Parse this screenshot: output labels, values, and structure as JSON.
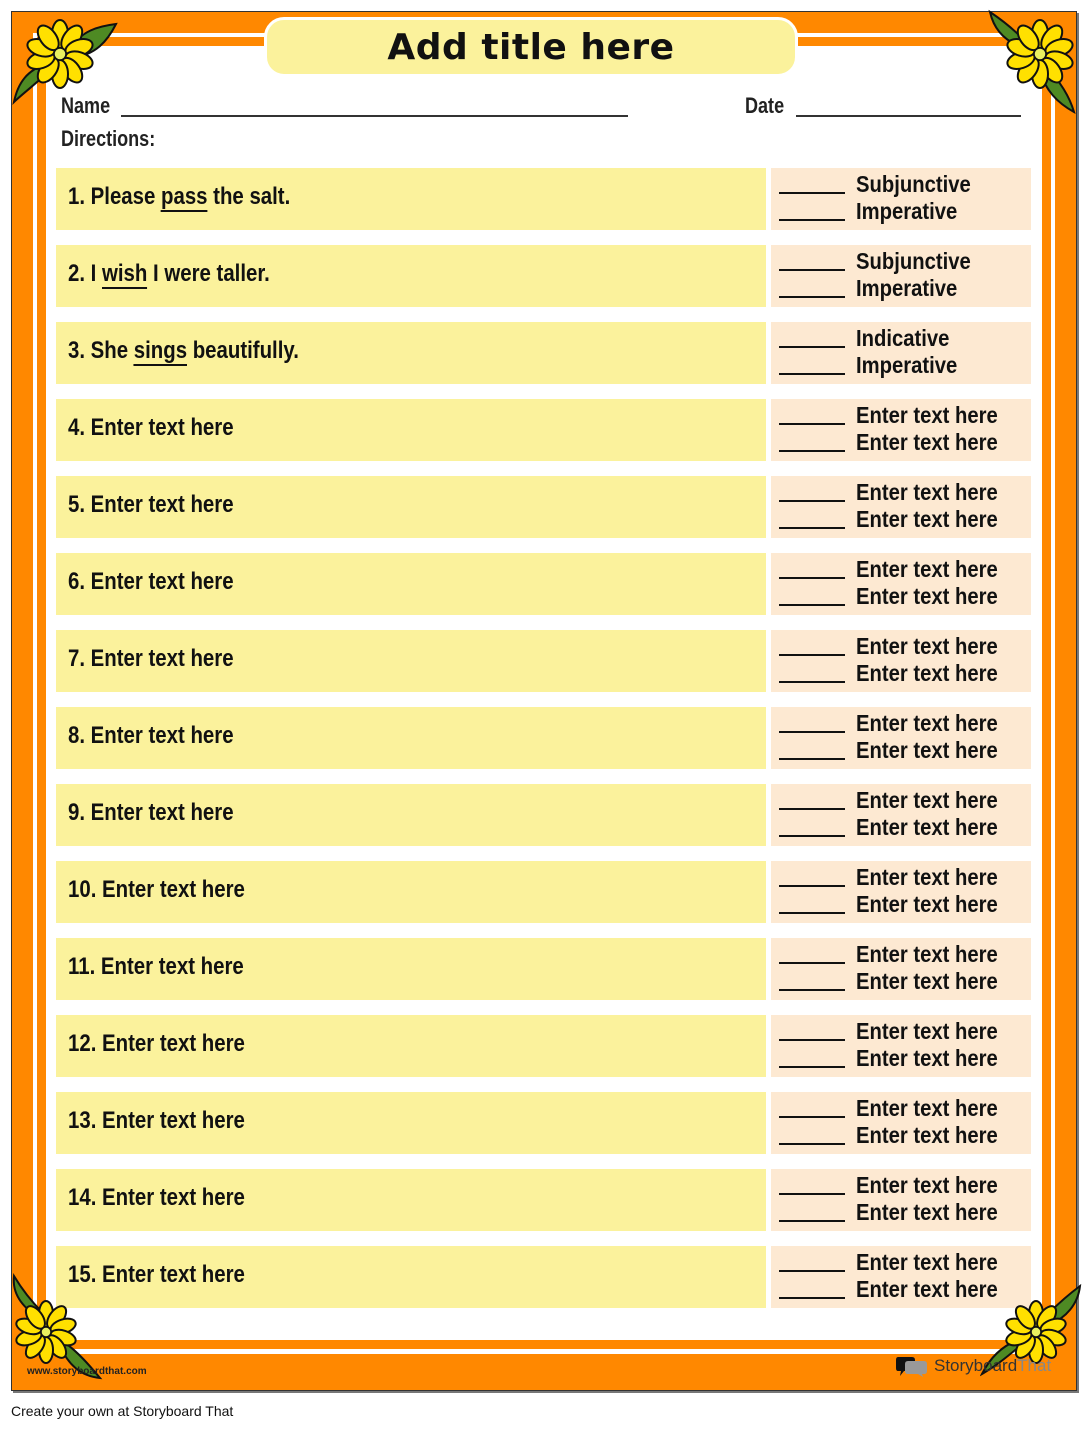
{
  "worksheet": {
    "title": "Add title here",
    "name_label": "Name",
    "date_label": "Date",
    "directions_label": "Directions:",
    "colors": {
      "border_orange": "#ff8800",
      "question_bg": "#fbf29c",
      "options_bg": "#fde9d2",
      "flower_yellow": "#ffe000",
      "leaf_green": "#4e8a23"
    },
    "questions": [
      {
        "number": "1.",
        "before": "Please ",
        "underlined": "pass",
        "after": " the salt.",
        "options": [
          "Subjunctive",
          "Imperative"
        ]
      },
      {
        "number": "2.",
        "before": "I ",
        "underlined": "wish",
        "after": " I were taller.",
        "options": [
          "Subjunctive",
          "Imperative"
        ]
      },
      {
        "number": "3.",
        "before": "She ",
        "underlined": "sings",
        "after": " beautifully.",
        "options": [
          "Indicative",
          "Imperative"
        ]
      },
      {
        "number": "4.",
        "before": "Enter text here",
        "underlined": "",
        "after": "",
        "options": [
          "Enter text here",
          "Enter text here"
        ]
      },
      {
        "number": "5.",
        "before": "Enter text here",
        "underlined": "",
        "after": "",
        "options": [
          "Enter text here",
          "Enter text here"
        ]
      },
      {
        "number": "6.",
        "before": "Enter text here",
        "underlined": "",
        "after": "",
        "options": [
          "Enter text here",
          "Enter text here"
        ]
      },
      {
        "number": "7.",
        "before": "Enter text here",
        "underlined": "",
        "after": "",
        "options": [
          "Enter text here",
          "Enter text here"
        ]
      },
      {
        "number": "8.",
        "before": "Enter text here",
        "underlined": "",
        "after": "",
        "options": [
          "Enter text here",
          "Enter text here"
        ]
      },
      {
        "number": "9.",
        "before": "Enter text here",
        "underlined": "",
        "after": "",
        "options": [
          "Enter text here",
          "Enter text here"
        ]
      },
      {
        "number": "10.",
        "before": "Enter text here",
        "underlined": "",
        "after": "",
        "options": [
          "Enter text here",
          "Enter text here"
        ]
      },
      {
        "number": "11.",
        "before": "Enter text here",
        "underlined": "",
        "after": "",
        "options": [
          "Enter text here",
          "Enter text here"
        ]
      },
      {
        "number": "12.",
        "before": "Enter text here",
        "underlined": "",
        "after": "",
        "options": [
          "Enter text here",
          "Enter text here"
        ]
      },
      {
        "number": "13.",
        "before": "Enter text here",
        "underlined": "",
        "after": "",
        "options": [
          "Enter text here",
          "Enter text here"
        ]
      },
      {
        "number": "14.",
        "before": "Enter text here",
        "underlined": "",
        "after": "",
        "options": [
          "Enter text here",
          "Enter text here"
        ]
      },
      {
        "number": "15.",
        "before": "Enter text here",
        "underlined": "",
        "after": "",
        "options": [
          "Enter text here",
          "Enter text here"
        ]
      }
    ]
  },
  "footer": {
    "website": "www.storyboardthat.com",
    "brand_name_part1": "Storyboard",
    "brand_name_part2": "That",
    "brand_icon": "speech-bubbles-icon",
    "corner_decoration_icon": "flower-icon",
    "credit": "Create your own at Storyboard That"
  }
}
